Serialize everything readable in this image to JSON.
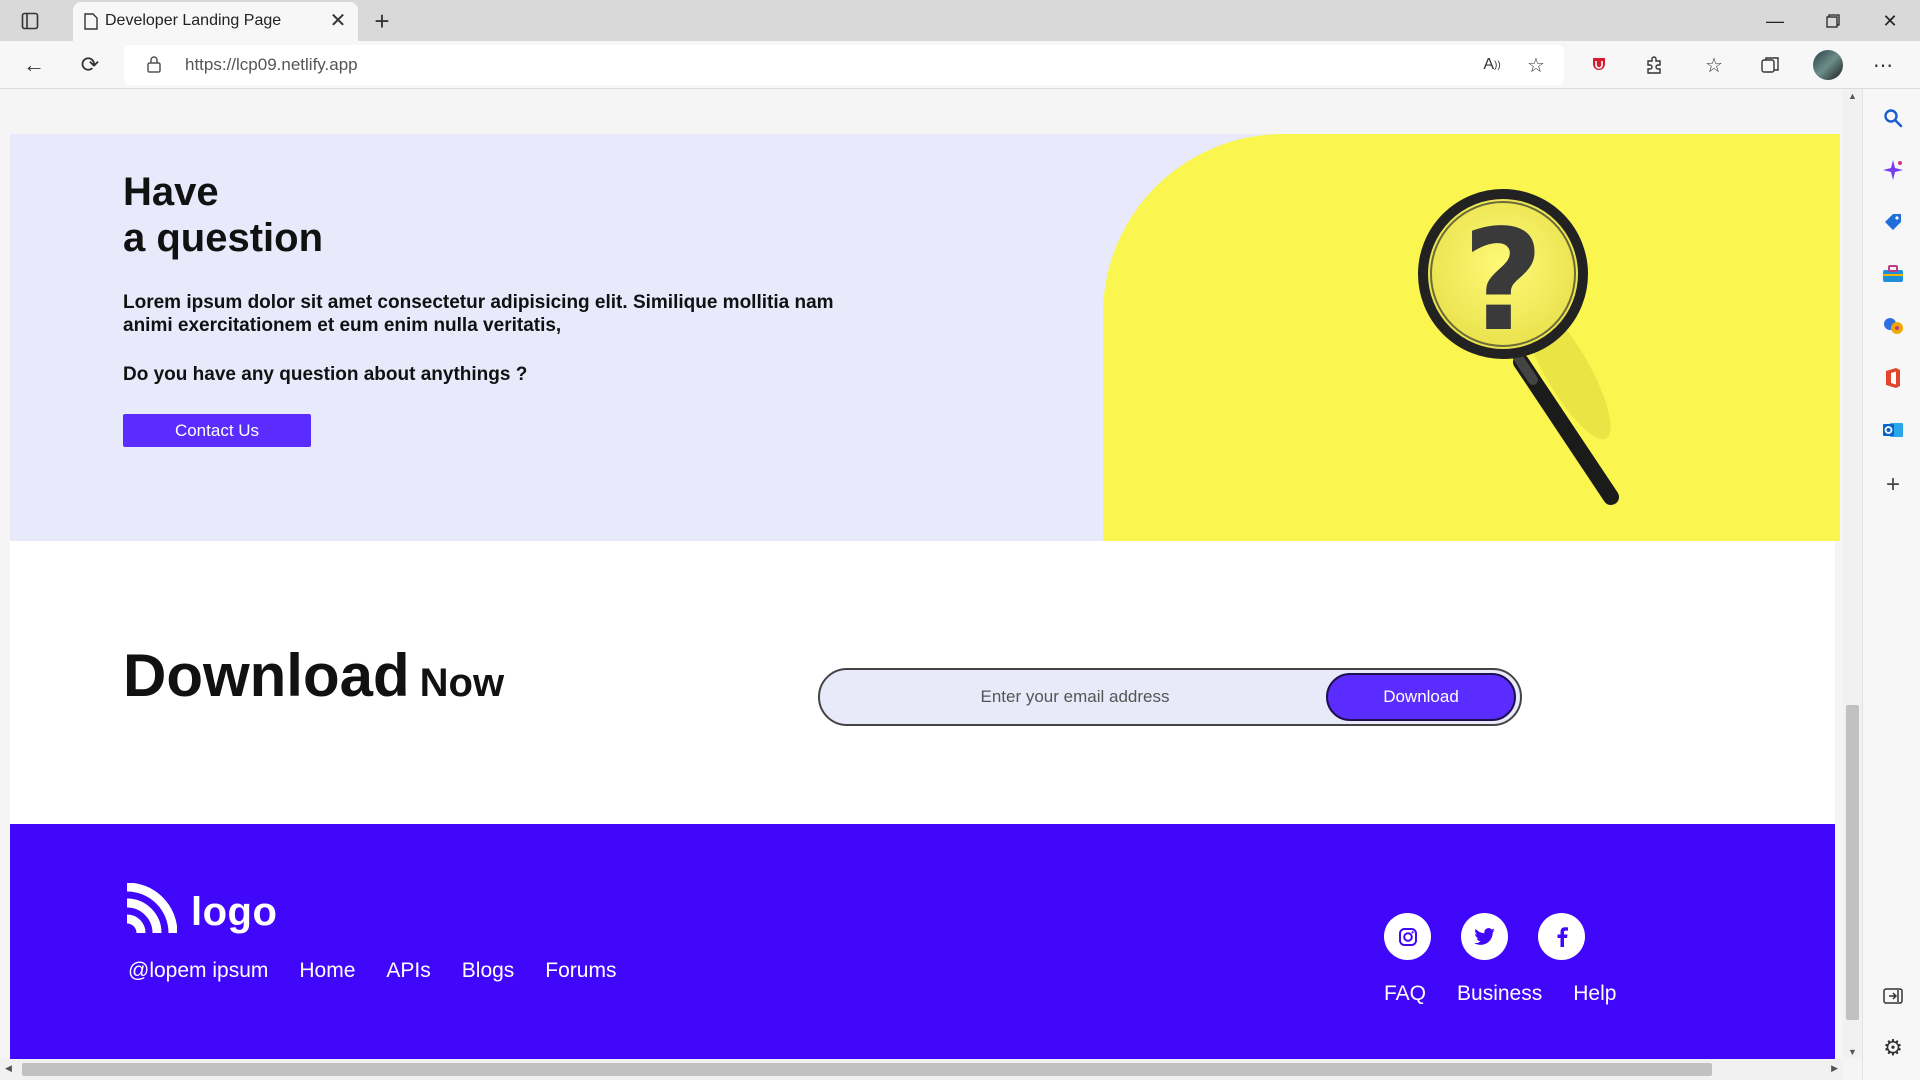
{
  "browser": {
    "tab_title": "Developer Landing Page",
    "url": "https://lcp09.netlify.app",
    "icons": [
      "tab-actions-icon",
      "page-icon",
      "close-icon",
      "new-tab-icon",
      "minimize-icon",
      "restore-icon",
      "close-window-icon",
      "back-icon",
      "refresh-icon",
      "lock-icon",
      "read-aloud-icon",
      "add-favorite-icon",
      "extension-shield-icon",
      "extensions-icon",
      "favorites-icon",
      "collections-icon",
      "profile-avatar",
      "more-icon"
    ]
  },
  "sidebar": {
    "icons": [
      "search-icon",
      "copilot-icon",
      "shopping-tag-icon",
      "tools-icon",
      "games-icon",
      "office-icon",
      "outlook-icon",
      "add-icon",
      "split-screen-icon",
      "settings-icon"
    ]
  },
  "question": {
    "title_line1": "Have",
    "title_line2": "a question",
    "description": "Lorem ipsum dolor sit amet consectetur adipisicing elit. Similique mollitia nam animi exercitationem et eum enim nulla veritatis,",
    "ask": "Do you have any question about anythings ?",
    "contact_label": "Contact Us",
    "image_icon": "magnifier-question-icon"
  },
  "download": {
    "title_big": "Download",
    "title_small": "Now",
    "email_placeholder": "Enter your email address",
    "button_label": "Download"
  },
  "footer": {
    "logo_text": "logo",
    "links": [
      "@lopem ipsum",
      "Home",
      "APIs",
      "Blogs",
      "Forums"
    ],
    "social": [
      "instagram-icon",
      "twitter-icon",
      "facebook-icon"
    ],
    "links_right": [
      "FAQ",
      "Business",
      "Help"
    ]
  },
  "colors": {
    "accent": "#5a2cff",
    "footer_bg": "#4007fb",
    "question_bg": "#e8e9fb",
    "image_bg": "#fbf64f"
  }
}
